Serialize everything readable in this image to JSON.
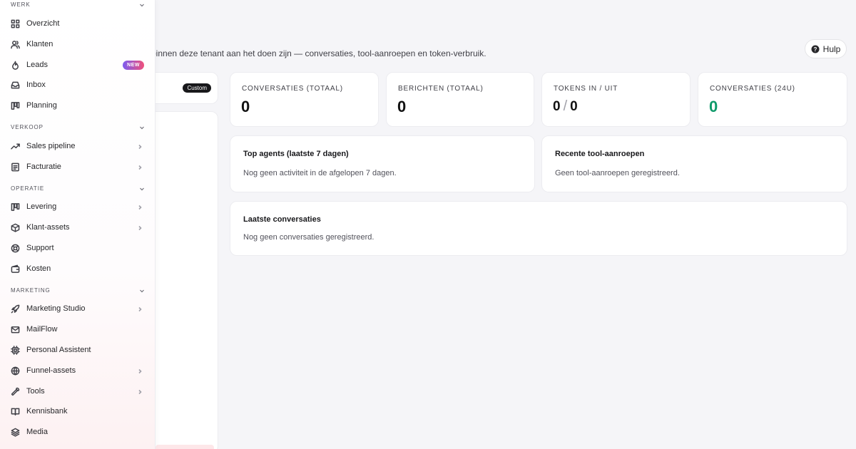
{
  "header": {
    "subtitle": "binnen deze tenant aan het doen zijn — conversaties, tool-aanroepen en token-verbruik.",
    "help_label": "Hulp"
  },
  "left_card": {
    "badge": "Custom"
  },
  "stats": [
    {
      "label": "CONVERSATIES (TOTAAL)",
      "value": "0"
    },
    {
      "label": "BERICHTEN (TOTAAL)",
      "value": "0"
    },
    {
      "label": "TOKENS IN / UIT",
      "value_in": "0",
      "separator": "/",
      "value_out": "0"
    },
    {
      "label": "CONVERSATIES (24U)",
      "value": "0"
    }
  ],
  "panels": {
    "top_agents": {
      "title": "Top agents (laatste 7 dagen)",
      "empty": "Nog geen activiteit in de afgelopen 7 dagen."
    },
    "recent_tools": {
      "title": "Recente tool-aanroepen",
      "empty": "Geen tool-aanroepen geregistreerd."
    },
    "latest_conversations": {
      "title": "Laatste conversaties",
      "empty": "Nog geen conversaties geregistreerd."
    }
  },
  "sidebar": {
    "sections": [
      {
        "label": "WERK"
      },
      {
        "label": "VERKOOP"
      },
      {
        "label": "OPERATIE"
      },
      {
        "label": "MARKETING"
      }
    ],
    "items": [
      {
        "label": "Overzicht",
        "icon": "grid-icon"
      },
      {
        "label": "Klanten",
        "icon": "users-icon"
      },
      {
        "label": "Leads",
        "icon": "flame-icon",
        "badge": "NEW"
      },
      {
        "label": "Inbox",
        "icon": "inbox-icon"
      },
      {
        "label": "Planning",
        "icon": "kanban-icon"
      },
      {
        "label": "Sales pipeline",
        "icon": "trend-icon"
      },
      {
        "label": "Facturatie",
        "icon": "document-icon"
      },
      {
        "label": "Levering",
        "icon": "kanban-icon"
      },
      {
        "label": "Klant-assets",
        "icon": "box-icon"
      },
      {
        "label": "Support",
        "icon": "lifebuoy-icon"
      },
      {
        "label": "Kosten",
        "icon": "wallet-icon"
      },
      {
        "label": "Marketing Studio",
        "icon": "rocket-icon"
      },
      {
        "label": "MailFlow",
        "icon": "mail-icon"
      },
      {
        "label": "Personal Assistent",
        "icon": "chip-icon"
      },
      {
        "label": "Funnel-assets",
        "icon": "globe-icon"
      },
      {
        "label": "Tools",
        "icon": "wrench-icon"
      },
      {
        "label": "Kennisbank",
        "icon": "book-icon"
      },
      {
        "label": "Media",
        "icon": "layers-icon"
      }
    ]
  }
}
